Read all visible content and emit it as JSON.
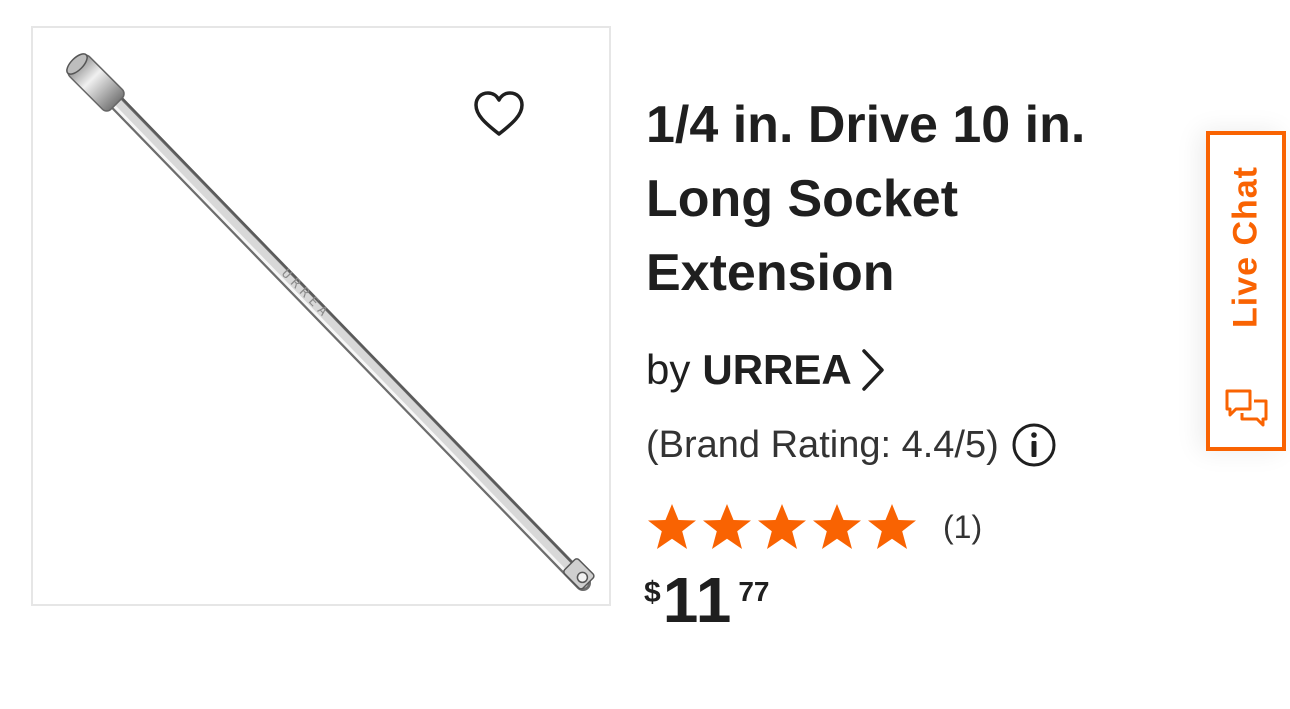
{
  "product": {
    "title": "1/4 in. Drive 10 in. Long Socket Extension",
    "by_prefix": "by",
    "brand": "URREA",
    "brand_rating": "(Brand Rating: 4.4/5)",
    "rating": {
      "stars": 5,
      "max_stars": 5,
      "review_count": "(1)"
    },
    "price": {
      "currency": "$",
      "dollars": "11",
      "cents": "77"
    },
    "image_engraving": "URREA"
  },
  "live_chat": {
    "label": "Live Chat"
  },
  "icons": {
    "favorite": "heart-outline-icon",
    "brand_link": "chevron-right-icon",
    "info": "info-circle-icon",
    "chat": "chat-bubbles-icon",
    "star": "star-filled-icon"
  },
  "colors": {
    "accent": "#f96302",
    "text": "#1f1f1f",
    "border": "#e6e6e6"
  }
}
